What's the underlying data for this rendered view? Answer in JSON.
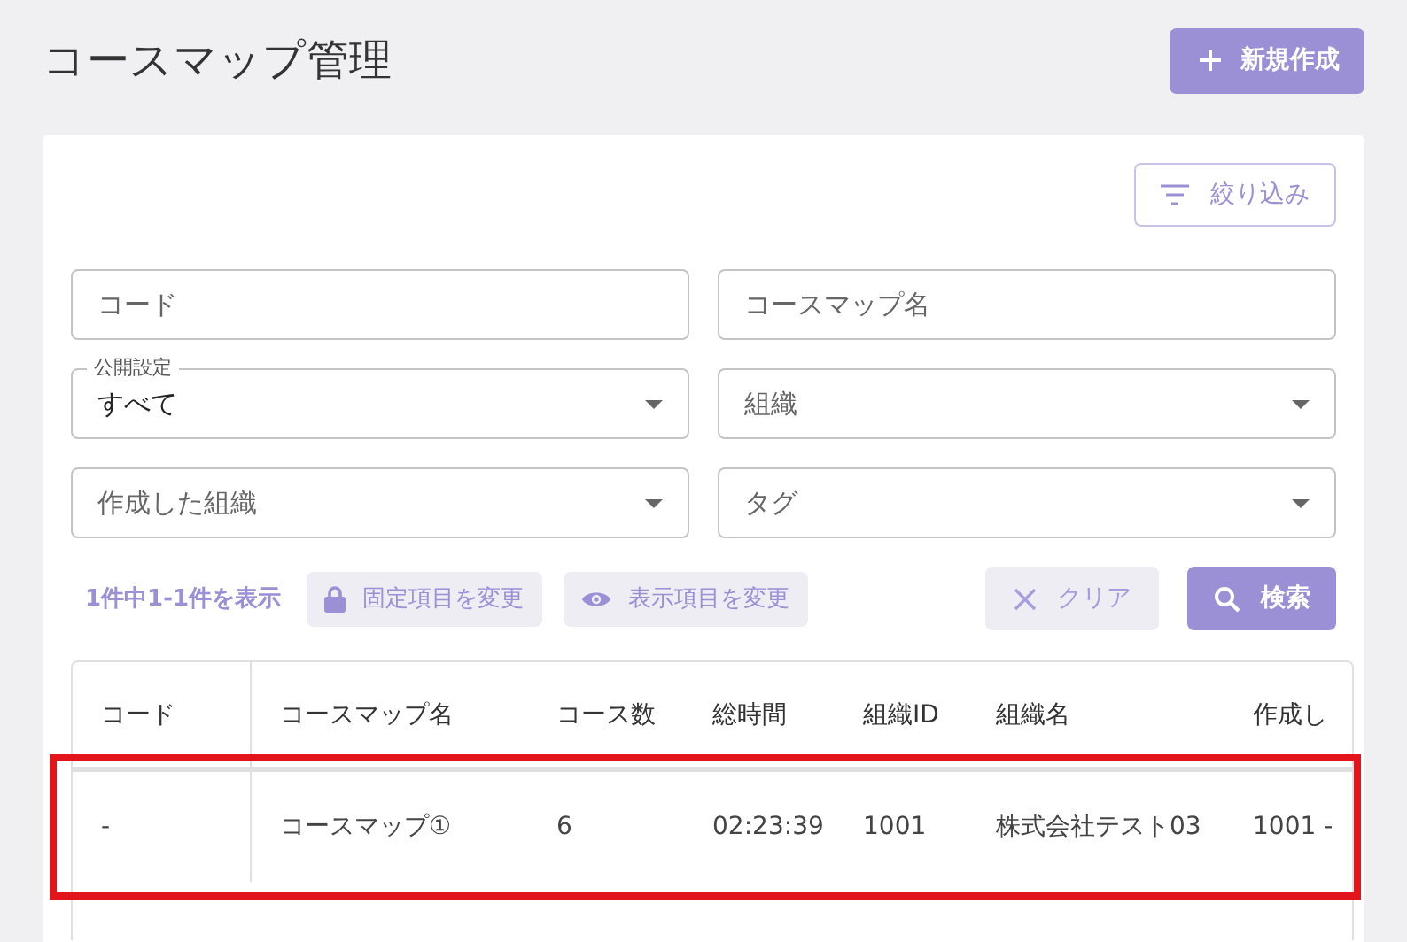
{
  "page": {
    "title": "コースマップ管理"
  },
  "new_button": {
    "label": "新規作成"
  },
  "filter_button": {
    "label": "絞り込み"
  },
  "fields": [
    {
      "kind": "text",
      "placeholder": "コード"
    },
    {
      "kind": "text",
      "placeholder": "コースマップ名"
    },
    {
      "kind": "select",
      "label": "公開設定",
      "value": "すべて"
    },
    {
      "kind": "select",
      "placeholder": "組織"
    },
    {
      "kind": "select",
      "placeholder": "作成した組織"
    },
    {
      "kind": "select",
      "placeholder": "タグ"
    }
  ],
  "result_count": "1件中1-1件を表示",
  "toolbar_buttons": [
    {
      "kind": "lock",
      "label": "固定項目を変更"
    },
    {
      "kind": "eye",
      "label": "表示項目を変更"
    }
  ],
  "clear_button": {
    "label": "クリア"
  },
  "search_button": {
    "label": "検索"
  },
  "table": {
    "columns": [
      "コード",
      "コースマップ名",
      "コース数",
      "総時間",
      "組織ID",
      "組織名",
      "作成し"
    ],
    "rows": [
      {
        "highlighted": true,
        "cells": [
          "-",
          "コースマップ①",
          "6",
          "02:23:39",
          "1001",
          "株式会社テスト03",
          "1001 -"
        ]
      }
    ]
  }
}
